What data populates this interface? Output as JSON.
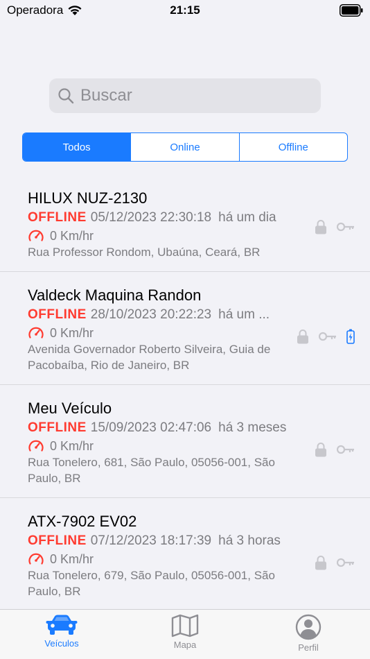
{
  "status_bar": {
    "carrier": "Operadora",
    "time": "21:15"
  },
  "search": {
    "placeholder": "Buscar"
  },
  "filters": [
    {
      "label": "Todos",
      "active": true
    },
    {
      "label": "Online",
      "active": false
    },
    {
      "label": "Offline",
      "active": false
    }
  ],
  "vehicles": [
    {
      "name": "HILUX NUZ-2130",
      "status": "OFFLINE",
      "datetime": "05/12/2023 22:30:18",
      "ago": "há um dia",
      "speed": "0 Km/hr",
      "address": "Rua Professor Rondom, Ubaúna, Ceará, BR",
      "battery_icon": false
    },
    {
      "name": "Valdeck Maquina Randon",
      "status": "OFFLINE",
      "datetime": "28/10/2023 20:22:23",
      "ago": "há um ...",
      "speed": "0 Km/hr",
      "address": "Avenida Governador Roberto Silveira, Guia de Pacobaíba, Rio de Janeiro, BR",
      "battery_icon": true
    },
    {
      "name": "Meu Veículo",
      "status": "OFFLINE",
      "datetime": "15/09/2023 02:47:06",
      "ago": "há 3 meses",
      "speed": "0 Km/hr",
      "address": "Rua Tonelero, 681, São Paulo, 05056-001, São Paulo, BR",
      "battery_icon": false
    },
    {
      "name": "ATX-7902 EV02",
      "status": "OFFLINE",
      "datetime": "07/12/2023 18:17:39",
      "ago": "há 3 horas",
      "speed": "0 Km/hr",
      "address": "Rua Tonelero, 679, São Paulo, 05056-001, São Paulo, BR",
      "battery_icon": false
    }
  ],
  "tabbar": [
    {
      "label": "Veículos",
      "icon": "car-icon",
      "active": true
    },
    {
      "label": "Mapa",
      "icon": "map-icon",
      "active": false
    },
    {
      "label": "Perfil",
      "icon": "profile-icon",
      "active": false
    }
  ],
  "colors": {
    "accent": "#1a7bff",
    "offline": "#ff3b30",
    "secondary_text": "#7c7c80",
    "icon_gray": "#c7c7cc"
  }
}
